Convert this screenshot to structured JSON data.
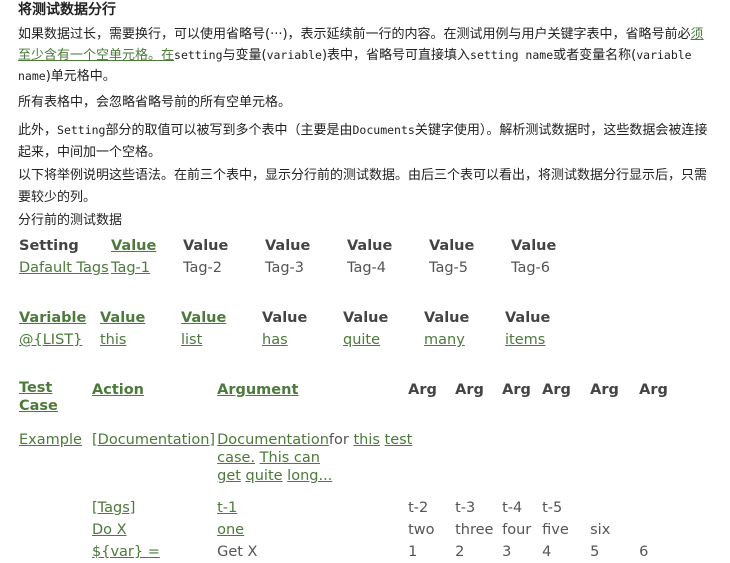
{
  "heading": "将测试数据分行",
  "p1": {
    "a": "如果数据过长，需要换行，可以使用省略号(···)，表示延续前一行的内容。在测试用例与用户关键字表中，省略号前必",
    "link1": "须至少含有一个空单元格。",
    "link2": "在",
    "b": "setting",
    "c": "与变量(",
    "d": "variable",
    "e": ")表中，省略号可直接填入",
    "f": "setting name",
    "g": "或者变量名称(",
    "h": "variable name",
    "i": ")单元格中。"
  },
  "p2": "所有表格中，会忽略省略号前的所有空单元格。",
  "p3": {
    "a": "此外，",
    "b": "Setting",
    "c": "部分的取值可以被写到多个表中（主要是由",
    "d": "Documents",
    "e": "关键字使用）。解析测试数据时，这些数据会被连接起来，中间加一个空格。"
  },
  "p4": "以下将举例说明这些语法。在前三个表中，显示分行前的测试数据。由后三个表可以看出，将测试数据分行显示后，只需要较少的列。",
  "p5": "分行前的测试数据",
  "t1": {
    "headers": [
      "Setting",
      "Value",
      "Value",
      "Value",
      "Value",
      "Value",
      "Value"
    ],
    "row": [
      "Dafault Tags",
      "Tag-1",
      "Tag-2",
      "Tag-3",
      "Tag-4",
      "Tag-5",
      "Tag-6"
    ]
  },
  "t2": {
    "headers": [
      "Variable",
      "Value",
      "Value",
      "Value",
      "Value",
      "Value",
      "Value"
    ],
    "row": [
      "@{LIST}",
      "this",
      "list",
      "has",
      "quite",
      "many",
      "items"
    ]
  },
  "t3": {
    "headers": [
      "Test Case",
      "Action",
      "Argument",
      "Arg",
      "Arg",
      "Arg",
      "Arg",
      "Arg",
      "Arg"
    ],
    "r1": {
      "case": "Example",
      "action": "[Documentation]",
      "arg_a": "Documentation",
      "arg_b": "for",
      "arg_c": "this",
      "arg_d": "test",
      "arg_e": "case.",
      "arg_f": "This can",
      "arg_g": "get",
      "arg_h": "quite",
      "arg_i": "long..."
    },
    "r2": [
      "",
      "[Tags]",
      "t-1",
      "t-2",
      "t-3",
      "t-4",
      "t-5",
      "",
      ""
    ],
    "r3": [
      "",
      "Do X",
      "one",
      "two",
      "three",
      "four",
      "five",
      "six",
      ""
    ],
    "r4": [
      "",
      "${var} =",
      "Get X",
      "1",
      "2",
      "3",
      "4",
      "5",
      "6"
    ]
  }
}
